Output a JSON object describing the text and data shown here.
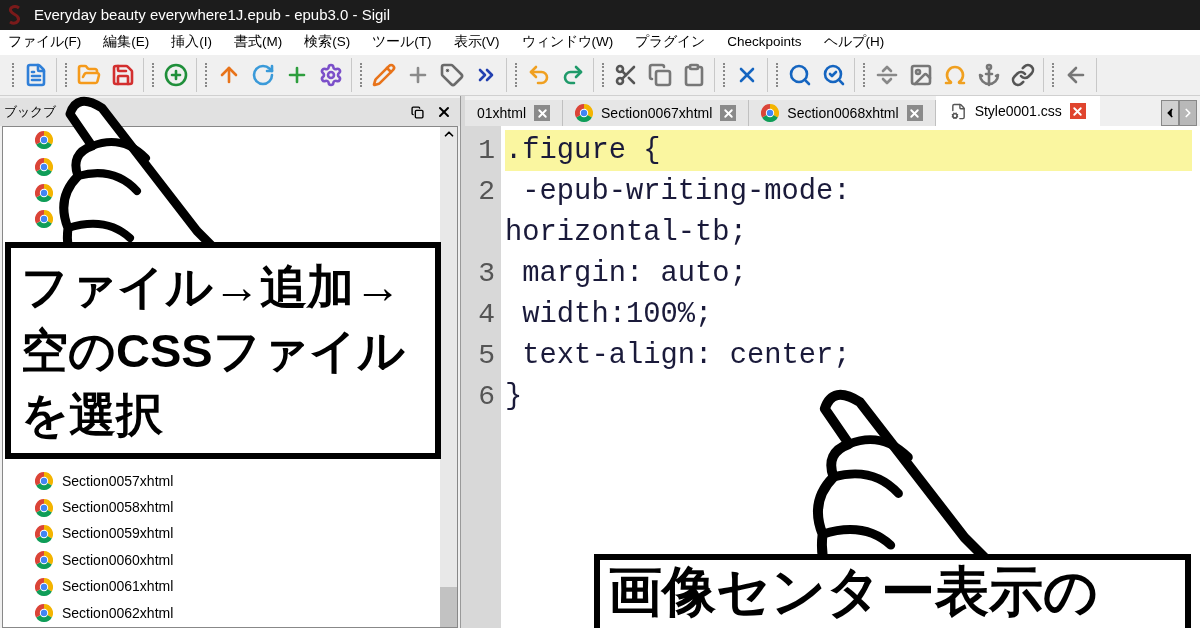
{
  "window": {
    "title": "Everyday beauty everywhere1J.epub - epub3.0 - Sigil"
  },
  "menu": [
    "ファイル(F)",
    "編集(E)",
    "挿入(I)",
    "書式(M)",
    "検索(S)",
    "ツール(T)",
    "表示(V)",
    "ウィンドウ(W)",
    "プラグイン",
    "Checkpoints",
    "ヘルプ(H)"
  ],
  "book_browser": {
    "title": "ブックブ",
    "items": [
      {
        "kind": "covered"
      },
      {
        "kind": "covered"
      },
      {
        "kind": "covered"
      },
      {
        "kind": "covered"
      },
      {
        "kind": "file",
        "label": "Section0057xhtml"
      },
      {
        "kind": "file",
        "label": "Section0058xhtml"
      },
      {
        "kind": "file",
        "label": "Section0059xhtml"
      },
      {
        "kind": "file",
        "label": "Section0060xhtml"
      },
      {
        "kind": "file",
        "label": "Section0061xhtml"
      },
      {
        "kind": "file",
        "label": "Section0062xhtml"
      }
    ]
  },
  "callouts": [
    {
      "lines": [
        "ファイル→追加→",
        "空のCSSファイル",
        "を選択"
      ]
    },
    {
      "lines": [
        "画像センター表示の"
      ]
    }
  ],
  "tabs": [
    {
      "label": "01xhtml",
      "kind": "html",
      "selected": false
    },
    {
      "label": "Section0067xhtml",
      "kind": "html",
      "selected": false
    },
    {
      "label": "Section0068xhtml",
      "kind": "html",
      "selected": false
    },
    {
      "label": "Style0001.css",
      "kind": "css",
      "selected": true
    }
  ],
  "editor": {
    "lines": [
      {
        "number": "1",
        "text": ".figure {",
        "current": true
      },
      {
        "number": "2",
        "text": " -epub-writing-mode:",
        "wrapped": "horizontal-tb;",
        "current": false
      },
      {
        "number": "3",
        "text": " margin: auto;",
        "current": false
      },
      {
        "number": "4",
        "text": " width:100%;",
        "current": false
      },
      {
        "number": "5",
        "text": " text-align: center;",
        "current": false
      },
      {
        "number": "6",
        "text": "}",
        "current": false
      }
    ]
  }
}
